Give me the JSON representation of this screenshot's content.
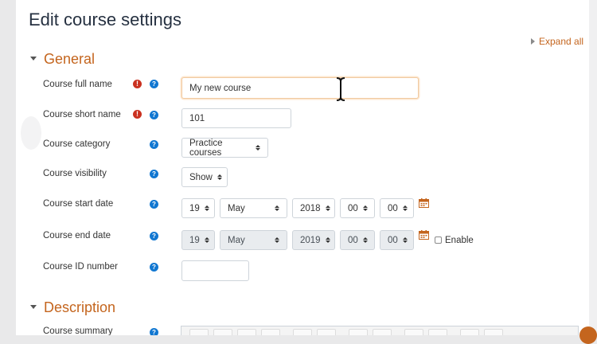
{
  "page": {
    "title": "Edit course settings",
    "expand_all": "Expand all"
  },
  "sections": {
    "general": "General",
    "description": "Description"
  },
  "fields": {
    "full_name": {
      "label": "Course full name",
      "value": "My new course",
      "required": true
    },
    "short_name": {
      "label": "Course short name",
      "value": "101",
      "required": true
    },
    "category": {
      "label": "Course category",
      "selected": "Practice courses"
    },
    "visibility": {
      "label": "Course visibility",
      "selected": "Show"
    },
    "start_date": {
      "label": "Course start date",
      "day": "19",
      "month": "May",
      "year": "2018",
      "hour": "00",
      "minute": "00"
    },
    "end_date": {
      "label": "Course end date",
      "day": "19",
      "month": "May",
      "year": "2019",
      "hour": "00",
      "minute": "00",
      "enable_label": "Enable",
      "enabled": false
    },
    "id_number": {
      "label": "Course ID number",
      "value": ""
    },
    "summary": {
      "label": "Course summary"
    }
  },
  "icons": {
    "required": "exclamation-icon",
    "help": "question-mark-icon",
    "calendar": "calendar-icon"
  },
  "colors": {
    "accent": "#c4651e",
    "help": "#1177d1",
    "required": "#ca3120",
    "title": "#263141"
  }
}
